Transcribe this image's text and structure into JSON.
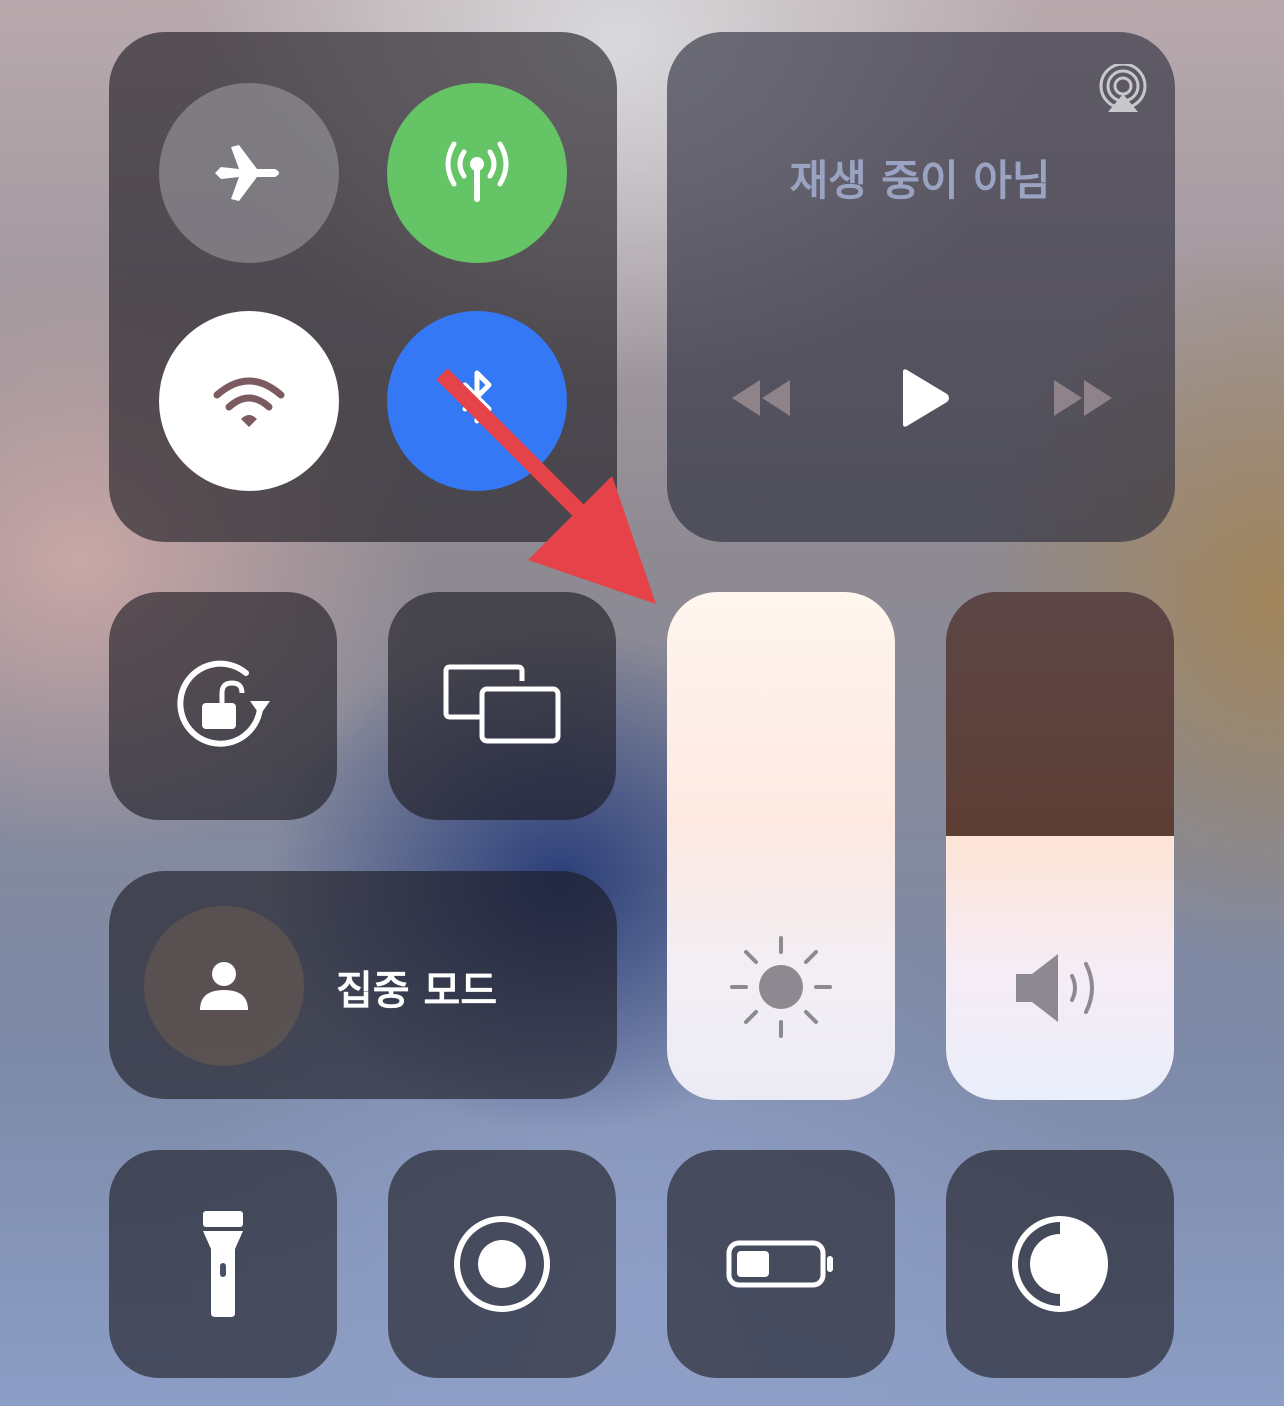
{
  "connectivity": {
    "airplane": {
      "icon": "airplane-icon",
      "state": "off"
    },
    "cellular": {
      "icon": "cellular-antenna-icon",
      "state": "on",
      "color": "#64c466"
    },
    "wifi": {
      "icon": "wifi-icon",
      "state": "on",
      "color": "#ffffff"
    },
    "bluetooth": {
      "icon": "bluetooth-icon",
      "state": "on",
      "color": "#3478f6"
    }
  },
  "now_playing": {
    "title": "재생 중이 아님",
    "airplay_icon": "airplay-audio-icon",
    "controls": [
      "rewind-icon",
      "play-icon",
      "fast-forward-icon"
    ]
  },
  "toggles": {
    "rotation_lock_icon": "rotation-lock-icon",
    "screen_mirroring_icon": "screen-mirroring-icon"
  },
  "focus": {
    "label": "집중 모드",
    "icon": "person-icon"
  },
  "brightness": {
    "level": 1.0,
    "icon": "sun-icon"
  },
  "volume": {
    "level": 0.52,
    "icon": "speaker-icon"
  },
  "bottom_row": [
    "flashlight-icon",
    "screen-record-icon",
    "low-power-mode-icon",
    "dark-mode-icon"
  ],
  "annotation": {
    "type": "arrow",
    "color": "#e5424a"
  }
}
